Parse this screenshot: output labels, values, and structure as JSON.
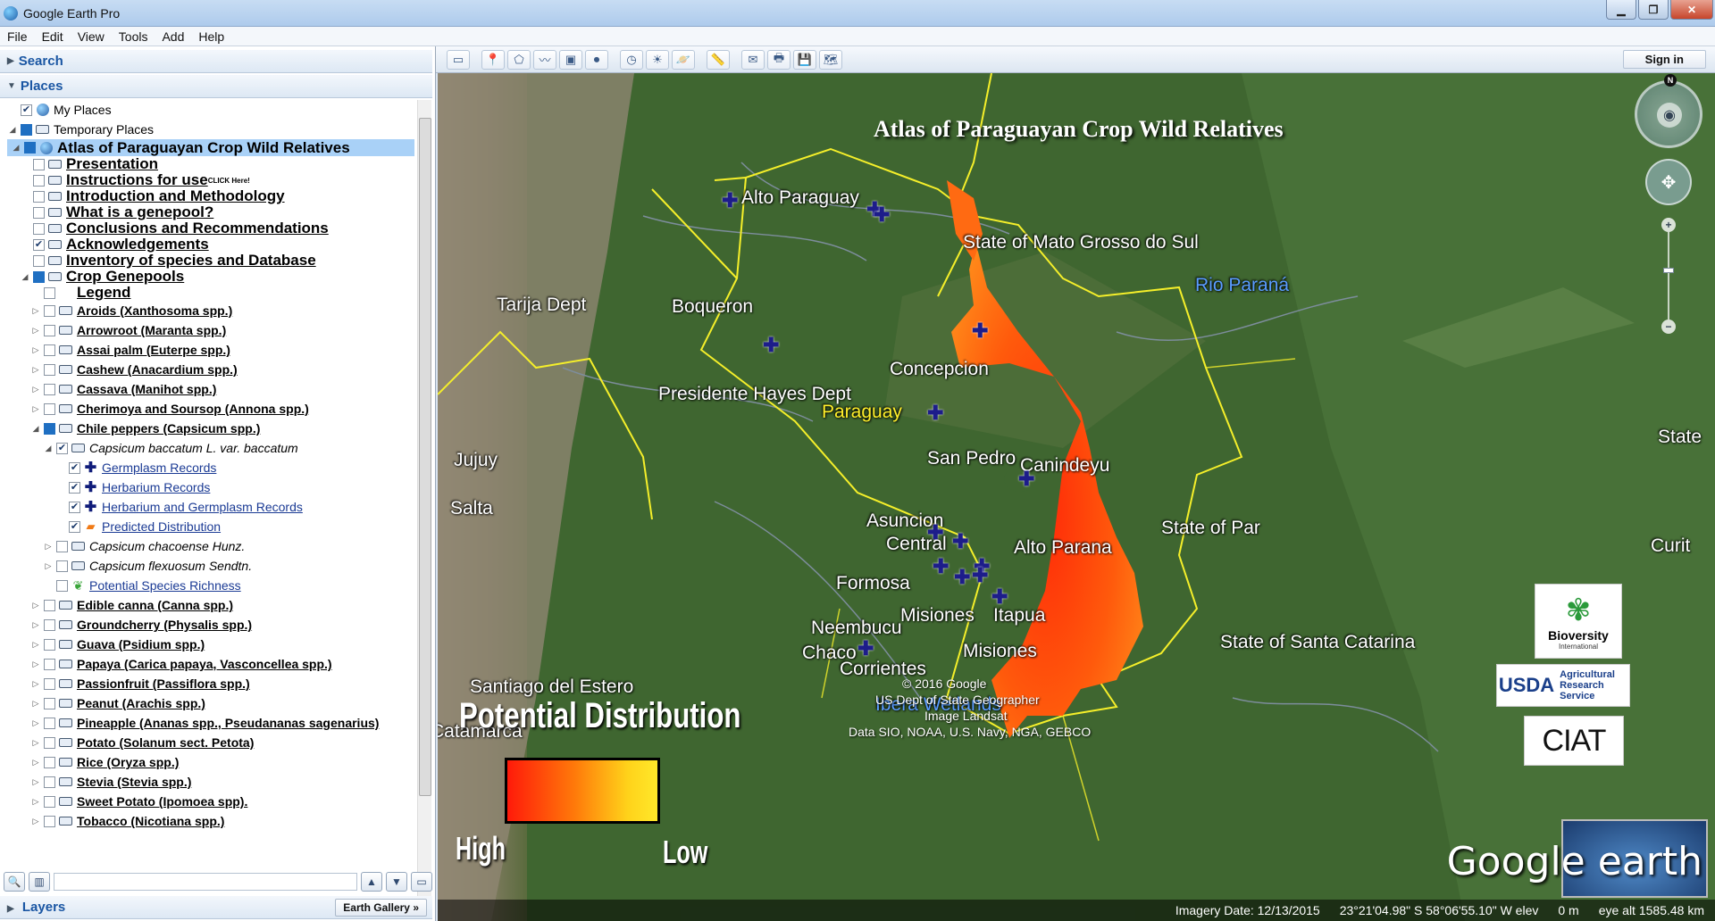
{
  "window": {
    "title": "Google Earth Pro",
    "minimize": "▁",
    "maximize": "❐",
    "close": "✕"
  },
  "menu": [
    "File",
    "Edit",
    "View",
    "Tools",
    "Add",
    "Help"
  ],
  "search_panel": {
    "label": "Search"
  },
  "places_panel": {
    "label": "Places",
    "items": [
      {
        "depth": 0,
        "expand": "",
        "cb": "on",
        "icon": "globe",
        "label": "My Places",
        "style": "norm"
      },
      {
        "depth": 0,
        "expand": "◢",
        "cb": "part",
        "icon": "folder",
        "label": "Temporary Places",
        "style": "norm"
      },
      {
        "depth": 1,
        "expand": "◢",
        "cb": "part",
        "icon": "globe",
        "label": "Atlas of Paraguayan Crop Wild Relatives",
        "style": "sel"
      },
      {
        "depth": 2,
        "expand": "",
        "cb": "off",
        "icon": "folder",
        "label": "Presentation",
        "style": "big"
      },
      {
        "depth": 2,
        "expand": "",
        "cb": "off",
        "icon": "folder",
        "label": "Instructions for use",
        "note": "CLICK Here!",
        "style": "big"
      },
      {
        "depth": 2,
        "expand": "",
        "cb": "off",
        "icon": "folder",
        "label": "Introduction and Methodology",
        "style": "big"
      },
      {
        "depth": 2,
        "expand": "",
        "cb": "off",
        "icon": "folder",
        "label": "What is a genepool?",
        "style": "big"
      },
      {
        "depth": 2,
        "expand": "",
        "cb": "off",
        "icon": "folder",
        "label": "Conclusions and Recommendations",
        "style": "big"
      },
      {
        "depth": 2,
        "expand": "",
        "cb": "on",
        "icon": "folder",
        "label": "Acknowledgements",
        "style": "big"
      },
      {
        "depth": 2,
        "expand": "",
        "cb": "off",
        "icon": "folder",
        "label": "Inventory of species and Database",
        "style": "big"
      },
      {
        "depth": 2,
        "expand": "◢",
        "cb": "part",
        "icon": "folder",
        "label": "Crop Genepools",
        "style": "big"
      },
      {
        "depth": 3,
        "expand": "",
        "cb": "off",
        "icon": "none",
        "label": "Legend",
        "style": "big"
      },
      {
        "depth": 3,
        "expand": "▷",
        "cb": "off",
        "icon": "folder",
        "label": "Aroids (Xanthosoma spp.)",
        "style": "med"
      },
      {
        "depth": 3,
        "expand": "▷",
        "cb": "off",
        "icon": "folder",
        "label": "Arrowroot (Maranta spp.)",
        "style": "med"
      },
      {
        "depth": 3,
        "expand": "▷",
        "cb": "off",
        "icon": "folder",
        "label": "Assai palm (Euterpe spp.)",
        "style": "med"
      },
      {
        "depth": 3,
        "expand": "▷",
        "cb": "off",
        "icon": "folder",
        "label": "Cashew (Anacardium spp.)",
        "style": "med"
      },
      {
        "depth": 3,
        "expand": "▷",
        "cb": "off",
        "icon": "folder",
        "label": "Cassava (Manihot spp.)",
        "style": "med"
      },
      {
        "depth": 3,
        "expand": "▷",
        "cb": "off",
        "icon": "folder",
        "label": "Cherimoya and Soursop (Annona spp.)",
        "style": "med"
      },
      {
        "depth": 3,
        "expand": "◢",
        "cb": "part",
        "icon": "folder",
        "label": "Chile peppers (Capsicum spp.)",
        "style": "med"
      },
      {
        "depth": 4,
        "expand": "◢",
        "cb": "on",
        "icon": "folder",
        "label": "Capsicum baccatum L. var. baccatum",
        "style": "it"
      },
      {
        "depth": 5,
        "expand": "",
        "cb": "on",
        "icon": "plus",
        "label": "Germplasm Records",
        "style": "link"
      },
      {
        "depth": 5,
        "expand": "",
        "cb": "on",
        "icon": "plus",
        "label": "Herbarium Records",
        "style": "link"
      },
      {
        "depth": 5,
        "expand": "",
        "cb": "on",
        "icon": "plus",
        "label": "Herbarium and Germplasm Records",
        "style": "link"
      },
      {
        "depth": 5,
        "expand": "",
        "cb": "on",
        "icon": "flame",
        "label": "Predicted Distribution",
        "style": "link"
      },
      {
        "depth": 4,
        "expand": "▷",
        "cb": "off",
        "icon": "folder",
        "label": "Capsicum chacoense Hunz.",
        "style": "it"
      },
      {
        "depth": 4,
        "expand": "▷",
        "cb": "off",
        "icon": "folder",
        "label": "Capsicum flexuosum Sendtn.",
        "style": "it"
      },
      {
        "depth": 4,
        "expand": "",
        "cb": "off",
        "icon": "leaf",
        "label": "Potential Species Richness",
        "style": "link"
      },
      {
        "depth": 3,
        "expand": "▷",
        "cb": "off",
        "icon": "folder",
        "label": "Edible canna (Canna spp.)",
        "style": "med"
      },
      {
        "depth": 3,
        "expand": "▷",
        "cb": "off",
        "icon": "folder",
        "label": "Groundcherry (Physalis spp.)",
        "style": "med"
      },
      {
        "depth": 3,
        "expand": "▷",
        "cb": "off",
        "icon": "folder",
        "label": "Guava (Psidium spp.)",
        "style": "med"
      },
      {
        "depth": 3,
        "expand": "▷",
        "cb": "off",
        "icon": "folder",
        "label": "Papaya (Carica papaya, Vasconcellea spp.)",
        "style": "med"
      },
      {
        "depth": 3,
        "expand": "▷",
        "cb": "off",
        "icon": "folder",
        "label": "Passionfruit (Passiflora spp.)",
        "style": "med"
      },
      {
        "depth": 3,
        "expand": "▷",
        "cb": "off",
        "icon": "folder",
        "label": "Peanut (Arachis spp.)",
        "style": "med"
      },
      {
        "depth": 3,
        "expand": "▷",
        "cb": "off",
        "icon": "folder",
        "label": "Pineapple (Ananas spp., Pseudananas sagenarius)",
        "style": "med"
      },
      {
        "depth": 3,
        "expand": "▷",
        "cb": "off",
        "icon": "folder",
        "label": "Potato (Solanum sect. Petota)",
        "style": "med"
      },
      {
        "depth": 3,
        "expand": "▷",
        "cb": "off",
        "icon": "folder",
        "label": "Rice (Oryza spp.)",
        "style": "med"
      },
      {
        "depth": 3,
        "expand": "▷",
        "cb": "off",
        "icon": "folder",
        "label": "Stevia (Stevia spp.)",
        "style": "med"
      },
      {
        "depth": 3,
        "expand": "▷",
        "cb": "off",
        "icon": "folder",
        "label": "Sweet Potato (Ipomoea spp).",
        "style": "med"
      },
      {
        "depth": 3,
        "expand": "▷",
        "cb": "off",
        "icon": "folder",
        "label": "Tobacco (Nicotiana spp.)",
        "style": "med"
      }
    ]
  },
  "layers_panel": {
    "label": "Layers",
    "gallery": "Earth Gallery »"
  },
  "toolbar": {
    "signin": "Sign in"
  },
  "map": {
    "title": "Atlas of Paraguayan Crop Wild Relatives",
    "labels": [
      {
        "t": "Alto Paraguay",
        "k": "white"
      },
      {
        "t": "State of Mato Grosso do Sul",
        "k": "white"
      },
      {
        "t": "Rio Paraná",
        "k": "blue"
      },
      {
        "t": "Tarija Dept",
        "k": "white"
      },
      {
        "t": "Boqueron",
        "k": "white"
      },
      {
        "t": "Concepcion",
        "k": "white"
      },
      {
        "t": "Presidente Hayes Dept",
        "k": "white"
      },
      {
        "t": "Paraguay",
        "k": "yellow"
      },
      {
        "t": "State",
        "k": "white"
      },
      {
        "t": "San Pedro",
        "k": "white"
      },
      {
        "t": "Canindeyu",
        "k": "white"
      },
      {
        "t": "Jujuy",
        "k": "white"
      },
      {
        "t": "Salta",
        "k": "white"
      },
      {
        "t": "Asuncion",
        "k": "white"
      },
      {
        "t": "Central",
        "k": "white"
      },
      {
        "t": "State of Par",
        "k": "white"
      },
      {
        "t": "Alto Parana",
        "k": "white"
      },
      {
        "t": "Curit",
        "k": "white"
      },
      {
        "t": "Formosa",
        "k": "white"
      },
      {
        "t": "Misiones",
        "k": "white"
      },
      {
        "t": "Itapua",
        "k": "white"
      },
      {
        "t": "Neembucu",
        "k": "white"
      },
      {
        "t": "Chaco",
        "k": "white"
      },
      {
        "t": "Misiones",
        "k": "white"
      },
      {
        "t": "Corrientes",
        "k": "white"
      },
      {
        "t": "State of Santa Catarina",
        "k": "white"
      },
      {
        "t": "Santiago del Estero",
        "k": "white"
      },
      {
        "t": "Catamarca",
        "k": "white"
      },
      {
        "t": "Ibera Wetlands",
        "k": "blue"
      }
    ],
    "legend": {
      "title": "Potential Distribution",
      "high": "High",
      "low": "Low"
    },
    "credits": [
      "© 2016 Google",
      "US Dept of State Geographer",
      "Image Landsat",
      "Data SIO, NOAA, U.S. Navy, NGA, GEBCO"
    ],
    "status": {
      "imagery_date": "Imagery Date: 12/13/2015",
      "coords": "23°21'04.98\" S   58°06'55.10\" W  elev",
      "elev": "0 m",
      "eye_alt": "eye alt 1585.48 km"
    },
    "logos": {
      "bioversity": "Bioversity",
      "bioversity_sub": "International",
      "usda": "USDA",
      "usda_sub": "Agricultural Research Service",
      "ciat": "CIAT"
    },
    "ge_logo": "Google earth",
    "compass_n": "N"
  }
}
